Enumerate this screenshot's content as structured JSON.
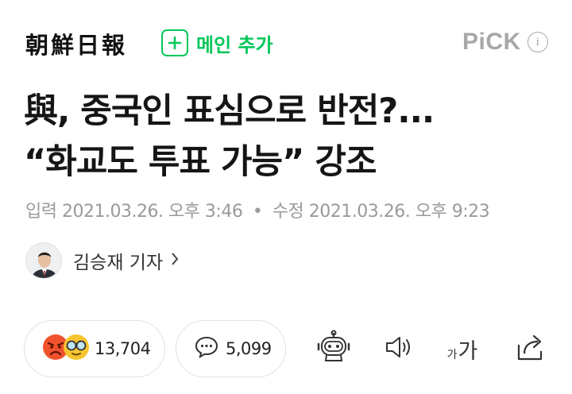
{
  "header": {
    "logo_text": "朝鮮日報",
    "add_main_label": "메인 추가",
    "pick_label": "PiCK",
    "info_label": "i"
  },
  "article": {
    "headline_line1": "與, 중국인 표심으로 반전?...",
    "headline_line2": "“화교도 투표 가능” 강조",
    "published_label": "입력",
    "published_date": "2021.03.26. 오후 3:46",
    "separator": "•",
    "modified_label": "수정",
    "modified_date": "2021.03.26. 오후 9:23",
    "author_name": "김승재 기자"
  },
  "actions": {
    "reaction_count": "13,704",
    "comment_count": "5,099",
    "font_size_small": "가",
    "font_size_large": "가"
  },
  "colors": {
    "brand_green": "#03c75a",
    "muted_gray": "#9a9a9a"
  },
  "icons": [
    "plus-icon",
    "info-icon",
    "chevron-right-icon",
    "angry-reaction-icon",
    "glasses-reaction-icon",
    "comment-icon",
    "robot-summary-icon",
    "speaker-icon",
    "font-size-icon",
    "share-icon"
  ]
}
